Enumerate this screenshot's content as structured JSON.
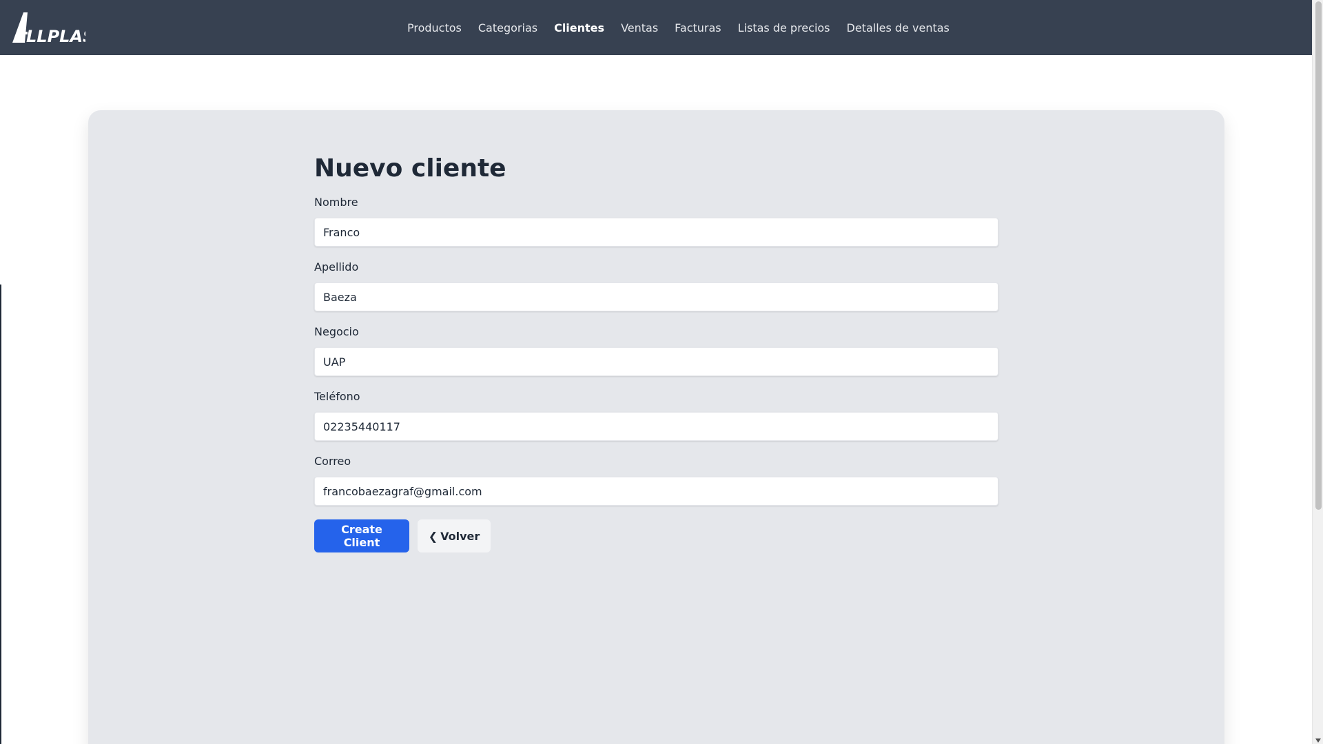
{
  "nav": {
    "brand": "ALLPLAST",
    "links": [
      {
        "label": "Productos",
        "active": false
      },
      {
        "label": "Categorias",
        "active": false
      },
      {
        "label": "Clientes",
        "active": true
      },
      {
        "label": "Ventas",
        "active": false
      },
      {
        "label": "Facturas",
        "active": false
      },
      {
        "label": "Listas de precios",
        "active": false
      },
      {
        "label": "Detalles de ventas",
        "active": false
      }
    ]
  },
  "form": {
    "title": "Nuevo cliente",
    "fields": [
      {
        "label": "Nombre",
        "value": "Franco"
      },
      {
        "label": "Apellido",
        "value": "Baeza"
      },
      {
        "label": "Negocio",
        "value": "UAP"
      },
      {
        "label": "Teléfono",
        "value": "02235440117"
      },
      {
        "label": "Correo",
        "value": "francobaezagraf@gmail.com"
      }
    ],
    "submit_label": "Create Client",
    "back_label": "Volver",
    "back_icon": "❮"
  },
  "colors": {
    "nav_bg": "#374151",
    "card_bg": "#e5e7eb",
    "primary": "#2563eb",
    "text": "#1f2937"
  }
}
